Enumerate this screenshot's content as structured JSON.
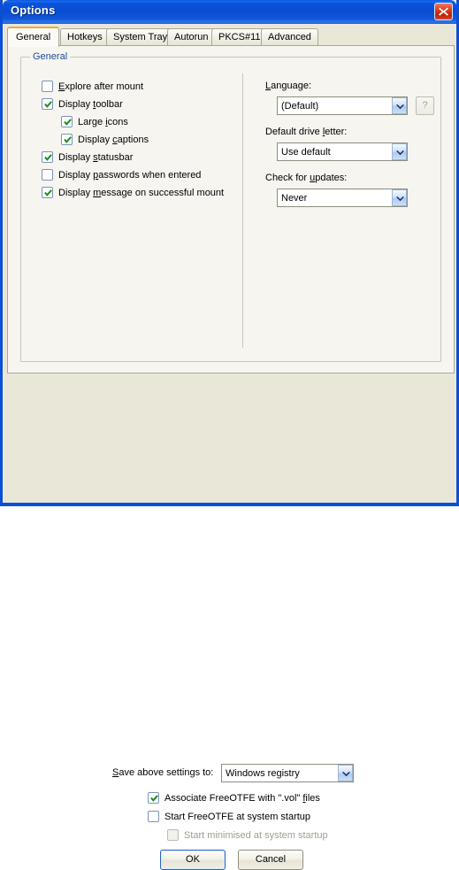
{
  "window": {
    "title": "Options",
    "close_icon": "close-icon"
  },
  "tabs": [
    {
      "label": "General",
      "active": true
    },
    {
      "label": "Hotkeys",
      "active": false
    },
    {
      "label": "System Tray",
      "active": false
    },
    {
      "label": "Autorun",
      "active": false
    },
    {
      "label": "PKCS#11",
      "active": false
    },
    {
      "label": "Advanced",
      "active": false
    }
  ],
  "general_group": {
    "title": "General",
    "checkboxes": [
      {
        "label_pre": "",
        "accel": "E",
        "label_post": "xplore after mount",
        "checked": false,
        "indent": 0
      },
      {
        "label_pre": "Display ",
        "accel": "t",
        "label_post": "oolbar",
        "checked": true,
        "indent": 0
      },
      {
        "label_pre": "Large ",
        "accel": "i",
        "label_post": "cons",
        "checked": true,
        "indent": 1
      },
      {
        "label_pre": "Display ",
        "accel": "c",
        "label_post": "aptions",
        "checked": true,
        "indent": 1
      },
      {
        "label_pre": "Display ",
        "accel": "s",
        "label_post": "tatusbar",
        "checked": true,
        "indent": 0
      },
      {
        "label_pre": "Display ",
        "accel": "p",
        "label_post": "asswords when entered",
        "checked": false,
        "indent": 0
      },
      {
        "label_pre": "Display ",
        "accel": "m",
        "label_post": "essage on successful mount",
        "checked": true,
        "indent": 0
      }
    ],
    "fields": [
      {
        "label_pre": "",
        "label_accel": "L",
        "label_post": "anguage:",
        "value": "(Default)",
        "has_help": true,
        "help_label": "?"
      },
      {
        "label_pre": "Default drive ",
        "label_accel": "l",
        "label_post": "etter:",
        "value": "Use default",
        "has_help": false,
        "help_label": ""
      },
      {
        "label_pre": "Check for ",
        "label_accel": "u",
        "label_post": "pdates:",
        "value": "Never",
        "has_help": false,
        "help_label": ""
      }
    ]
  },
  "bottom": {
    "save_label_pre": "",
    "save_label_accel": "S",
    "save_label_post": "ave above settings to:",
    "save_value": "Windows registry",
    "checkboxes": [
      {
        "label_pre": "Associate FreeOTFE with \".vol\" ",
        "accel": "f",
        "label_post": "iles",
        "checked": true,
        "disabled": false
      },
      {
        "label_pre": "Start FreeOTFE at system startup",
        "accel": "",
        "label_post": "",
        "checked": false,
        "disabled": false
      },
      {
        "label_pre": "Start minimised at system startup",
        "accel": "",
        "label_post": "",
        "checked": false,
        "disabled": true
      }
    ],
    "ok_label": "OK",
    "cancel_label": "Cancel"
  },
  "colors": {
    "titlebar_blue": "#0A4CD2",
    "dialog_bg": "#E9E8D8",
    "panel_bg": "#F6F5F0",
    "group_title": "#1C4C93",
    "check_green": "#1D8C1D",
    "tab_accent": "#F0A83C",
    "close_red": "#C42A0A"
  }
}
